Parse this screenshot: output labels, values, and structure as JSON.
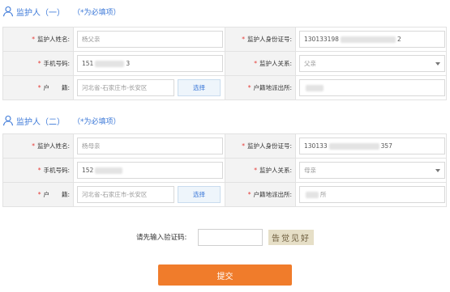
{
  "guardian1": {
    "title": "监护人（一）",
    "note": "（*为必填项）",
    "name_label": "监护人姓名:",
    "name_value": "杨父亲",
    "idcard_label": "监护人身份证号:",
    "idcard_prefix": "130133198",
    "idcard_suffix": "2",
    "phone_label": "手机号码:",
    "phone_prefix": "151",
    "phone_suffix": "3",
    "relation_label": "监护人关系:",
    "relation_value": "父亲",
    "hukou_label": "户　　籍:",
    "hukou_value": "河北省-石家庄市-长安区",
    "choose_label": "选择",
    "police_label": "户籍地派出所:"
  },
  "guardian2": {
    "title": "监护人（二）",
    "note": "（*为必填项）",
    "name_label": "监护人姓名:",
    "name_value": "杨母亲",
    "idcard_label": "监护人身份证号:",
    "idcard_prefix": "130133",
    "idcard_suffix": "357",
    "phone_label": "手机号码:",
    "phone_prefix": "152",
    "relation_label": "监护人关系:",
    "relation_value": "母亲",
    "hukou_label": "户　　籍:",
    "hukou_value": "河北省-石家庄市-长安区",
    "choose_label": "选择",
    "police_label": "户籍地派出所:",
    "police_suffix": "所"
  },
  "captcha": {
    "label": "请先输入验证码:",
    "image_text": "告觉见好"
  },
  "submit_label": "提交",
  "colors": {
    "accent": "#3b78d8",
    "required": "#e53935",
    "submit": "#f07c2b",
    "label_bg": "#f3f3f3"
  },
  "icons": {
    "section_icon": "person-outline-icon",
    "select_icon": "caret-down-icon"
  }
}
